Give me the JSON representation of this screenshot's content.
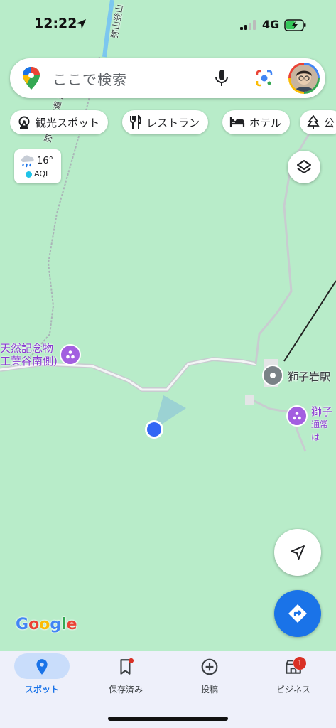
{
  "status_bar": {
    "time": "12:22",
    "network": "4G"
  },
  "search": {
    "placeholder": "ここで検索"
  },
  "chips": [
    {
      "label": "観光スポット",
      "icon": "ferris-wheel-icon"
    },
    {
      "label": "レストラン",
      "icon": "fork-knife-icon"
    },
    {
      "label": "ホテル",
      "icon": "bed-icon"
    },
    {
      "label": "公",
      "icon": "tree-icon"
    }
  ],
  "weather": {
    "temp": "16°",
    "aqi": "AQI",
    "icon": "rain-cloud-icon"
  },
  "map_labels": {
    "trail_1": "弥山登山道 紅葉谷コ",
    "trail_2": "弥山登山",
    "monument_line1": "天然記念物",
    "monument_line2": "工葉谷南側)",
    "station": "獅子岩駅",
    "poi_right_line1": "獅子",
    "poi_right_line2": "通常は"
  },
  "attribution": {
    "google": "Google"
  },
  "colors": {
    "map_bg": "#b8ecc9",
    "accent": "#1a73e8",
    "poi": "#a35ee0",
    "badge": "#d93025"
  },
  "bottom_nav": {
    "items": [
      {
        "label": "スポット",
        "icon": "location-pin-icon",
        "active": true
      },
      {
        "label": "保存済み",
        "icon": "bookmark-icon"
      },
      {
        "label": "投稿",
        "icon": "add-circle-icon"
      },
      {
        "label": "ビジネス",
        "icon": "storefront-icon",
        "badge": "1"
      }
    ]
  }
}
